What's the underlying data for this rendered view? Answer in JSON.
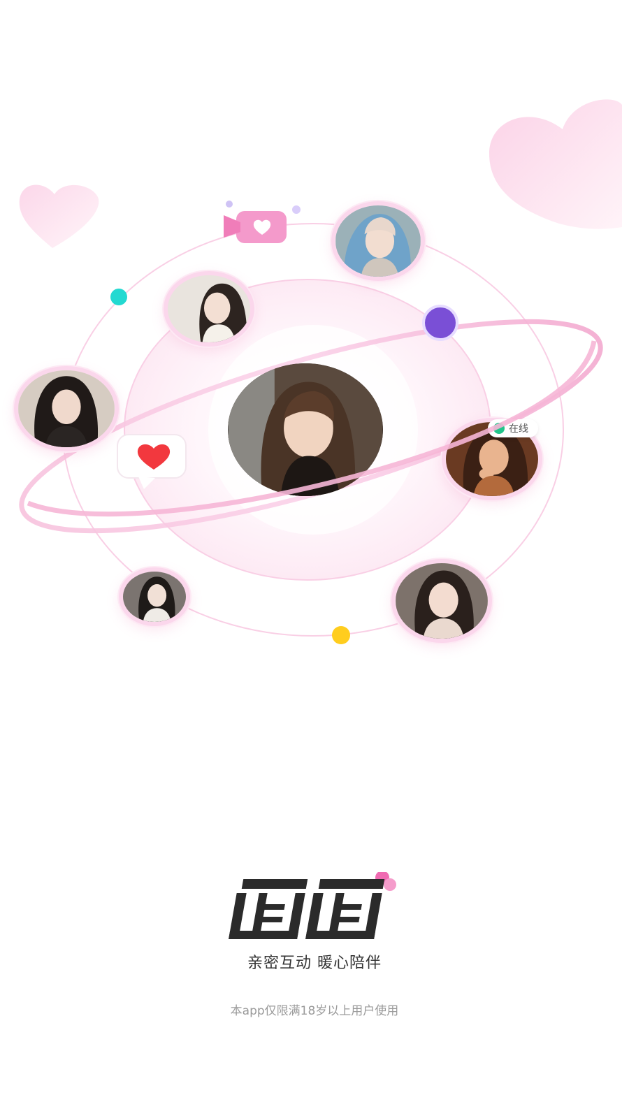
{
  "app": {
    "name": "面面",
    "tagline": "亲密互动 暖心陪伴",
    "age_notice": "本app仅限满18岁以上用户使用"
  },
  "badges": {
    "online_label": "在线"
  },
  "colors": {
    "brand_pink": "#f06bb2",
    "ring_pink": "#fbd3ea",
    "teal_dot": "#23d9d1",
    "purple_dot": "#7a4fd6",
    "yellow_dot": "#ffcd1e",
    "online_green": "#22c58b",
    "logo_dark": "#2b2b2b"
  },
  "icons": [
    "heart-decoration-icon",
    "video-call-heart-icon",
    "chat-heart-bubble-icon",
    "online-status-icon"
  ]
}
